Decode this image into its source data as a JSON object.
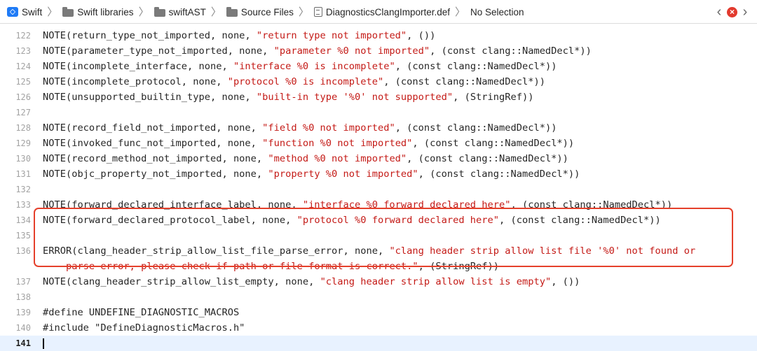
{
  "jumpbar": {
    "crumbs": [
      "Swift",
      "Swift libraries",
      "swiftAST",
      "Source Files",
      "DiagnosticsClangImporter.def",
      "No Selection"
    ],
    "separator": "〉",
    "back": "‹",
    "forward": "›",
    "issue_badge": "×"
  },
  "code": {
    "lines": [
      {
        "n": "122",
        "a": "NOTE(return_type_not_imported, none, ",
        "s": "\"return type not imported\"",
        "b": ", ())"
      },
      {
        "n": "123",
        "a": "NOTE(parameter_type_not_imported, none, ",
        "s": "\"parameter %0 not imported\"",
        "b": ", (const clang::NamedDecl*))"
      },
      {
        "n": "124",
        "a": "NOTE(incomplete_interface, none, ",
        "s": "\"interface %0 is incomplete\"",
        "b": ", (const clang::NamedDecl*))"
      },
      {
        "n": "125",
        "a": "NOTE(incomplete_protocol, none, ",
        "s": "\"protocol %0 is incomplete\"",
        "b": ", (const clang::NamedDecl*))"
      },
      {
        "n": "126",
        "a": "NOTE(unsupported_builtin_type, none, ",
        "s": "\"built-in type '%0' not supported\"",
        "b": ", (StringRef))"
      },
      {
        "n": "127",
        "a": "",
        "s": "",
        "b": ""
      },
      {
        "n": "128",
        "a": "NOTE(record_field_not_imported, none, ",
        "s": "\"field %0 not imported\"",
        "b": ", (const clang::NamedDecl*))"
      },
      {
        "n": "129",
        "a": "NOTE(invoked_func_not_imported, none, ",
        "s": "\"function %0 not imported\"",
        "b": ", (const clang::NamedDecl*))"
      },
      {
        "n": "130",
        "a": "NOTE(record_method_not_imported, none, ",
        "s": "\"method %0 not imported\"",
        "b": ", (const clang::NamedDecl*))"
      },
      {
        "n": "131",
        "a": "NOTE(objc_property_not_imported, none, ",
        "s": "\"property %0 not imported\"",
        "b": ", (const clang::NamedDecl*))"
      },
      {
        "n": "132",
        "a": "",
        "s": "",
        "b": ""
      },
      {
        "n": "133",
        "a": "NOTE(forward_declared_interface_label, none, ",
        "s": "\"interface %0 forward declared here\"",
        "b": ", (const clang::NamedDecl*))"
      },
      {
        "n": "134",
        "a": "NOTE(forward_declared_protocol_label, none, ",
        "s": "\"protocol %0 forward declared here\"",
        "b": ", (const clang::NamedDecl*))"
      },
      {
        "n": "135",
        "a": "",
        "s": "",
        "b": ""
      },
      {
        "n": "136",
        "a": "ERROR(clang_header_strip_allow_list_file_parse_error, none, ",
        "s": "\"clang header strip allow list file '%0' not found or",
        "b": ""
      },
      {
        "n": "",
        "a": "    ",
        "s": "parse error, please check if path or file format is correct.\"",
        "b": ", (StringRef))"
      },
      {
        "n": "137",
        "a": "NOTE(clang_header_strip_allow_list_empty, none, ",
        "s": "\"clang header strip allow list is empty\"",
        "b": ", ())"
      },
      {
        "n": "138",
        "a": "",
        "s": "",
        "b": ""
      },
      {
        "n": "139",
        "a": "#define UNDEFINE_DIAGNOSTIC_MACROS",
        "s": "",
        "b": ""
      },
      {
        "n": "140",
        "a": "#include \"DefineDiagnosticMacros.h\"",
        "s": "",
        "b": ""
      },
      {
        "n": "141",
        "a": "",
        "s": "",
        "b": ""
      }
    ]
  }
}
